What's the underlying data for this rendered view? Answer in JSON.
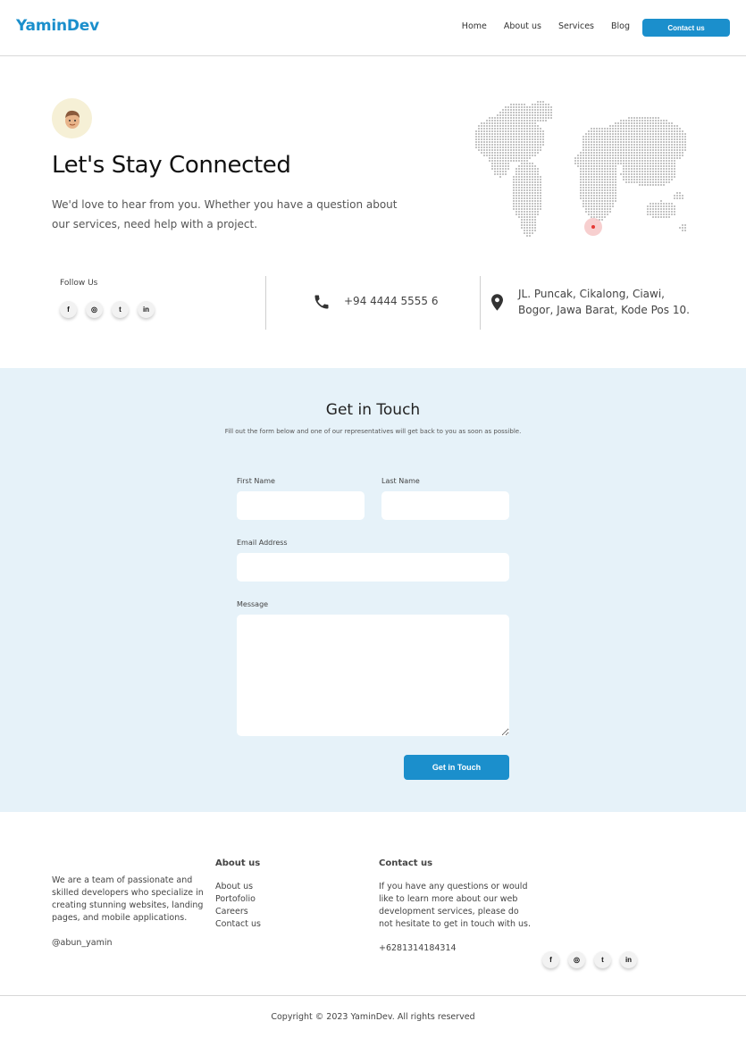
{
  "header": {
    "logo": "YaminDev",
    "nav": [
      "Home",
      "About us",
      "Services",
      "Blog"
    ],
    "cta": "Contact us"
  },
  "hero": {
    "title": "Let's Stay Connected",
    "description": "We'd love to hear from you. Whether you have a question about our services, need help with a project."
  },
  "info": {
    "follow_label": "Follow Us",
    "socials": [
      "f",
      "◎",
      "t",
      "in"
    ],
    "phone": "+94 4444 5555 6",
    "address": "JL. Puncak, Cikalong, Ciawi, Bogor, Jawa Barat, Kode Pos 10."
  },
  "contact_form": {
    "title": "Get in Touch",
    "subtitle": "Fill out the form below and one of our representatives will get back to you as soon as possible.",
    "first_name_label": "First Name",
    "last_name_label": "Last Name",
    "email_label": "Email Address",
    "message_label": "Message",
    "first_name_value": "",
    "last_name_value": "",
    "email_value": "",
    "message_value": "",
    "submit_label": "Get in Touch"
  },
  "footer": {
    "about_text": "We are a team of passionate and skilled developers who specialize in creating stunning websites, landing pages, and mobile applications.",
    "handle": "@abun_yamin",
    "about_heading": "About us",
    "about_links": [
      "About us",
      "Portofolio",
      "Careers",
      "Contact us"
    ],
    "contact_heading": "Contact us",
    "contact_text": "If you have any questions or would like to learn more about our web development services, please do not hesitate to get in touch with us.",
    "contact_phone": "+6281314184314",
    "socials": [
      "f",
      "◎",
      "t",
      "in"
    ],
    "copyright": "Copyright © 2023 YaminDev. All rights reserved"
  },
  "colors": {
    "accent": "#1b8fcc",
    "form_background": "#e6f2f9",
    "map_marker": "#e53935"
  }
}
